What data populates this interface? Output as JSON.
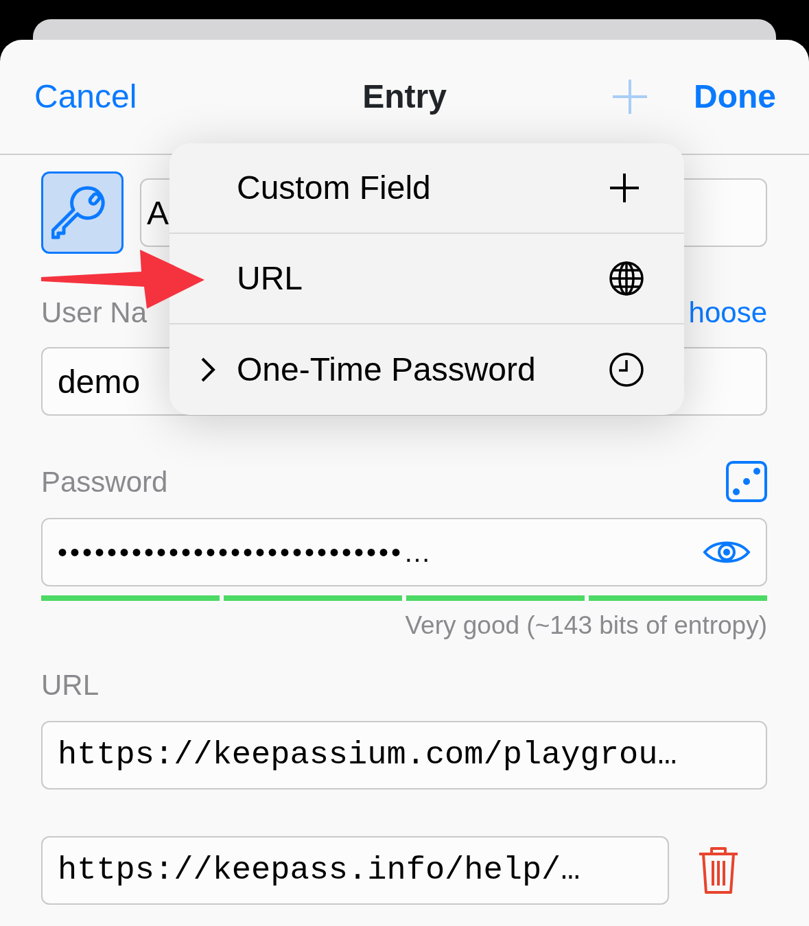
{
  "nav": {
    "cancel": "Cancel",
    "title": "Entry",
    "done": "Done"
  },
  "title_field": {
    "value": "A"
  },
  "username": {
    "label": "User Na",
    "action": "hoose",
    "value": "demo"
  },
  "password": {
    "label": "Password",
    "value": "••••••••••••••••••••••••••••…",
    "strength_segments": [
      {
        "filled": true
      },
      {
        "filled": true
      },
      {
        "filled": true
      },
      {
        "filled": true
      }
    ],
    "strength_text": "Very good (~143 bits of entropy)"
  },
  "url": {
    "label": "URL",
    "value": "https://keepassium.com/playgrou…"
  },
  "extra_urls": [
    {
      "value": "https://keepass.info/help/…"
    }
  ],
  "menu": {
    "items": [
      {
        "kind": "plus",
        "label": "Custom Field",
        "submenu": false
      },
      {
        "kind": "globe",
        "label": "URL",
        "submenu": false
      },
      {
        "kind": "clock",
        "label": "One-Time Password",
        "submenu": true
      }
    ]
  }
}
